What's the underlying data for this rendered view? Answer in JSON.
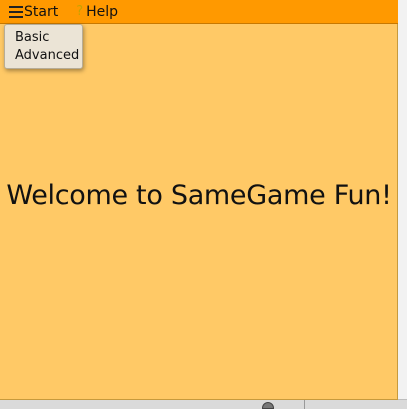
{
  "menubar": {
    "start_label": "Start",
    "help_icon": "?",
    "help_label": "Help"
  },
  "start_menu": {
    "items": [
      {
        "label": "Basic"
      },
      {
        "label": "Advanced"
      }
    ]
  },
  "main": {
    "welcome_text": "Welcome to SameGame Fun!"
  },
  "colors": {
    "menubar": "#ff9900",
    "canvas": "#ffc966",
    "menu_bg": "#ebe4d6"
  }
}
